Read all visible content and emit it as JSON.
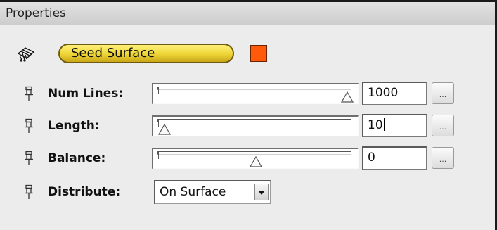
{
  "panel": {
    "title": "Properties"
  },
  "object": {
    "icon": "seed-surface-icon",
    "name": "Seed Surface",
    "color": "#ff5a0a"
  },
  "params": [
    {
      "label": "Num Lines:",
      "value": "1000",
      "slider_level": 1.0,
      "button": "..."
    },
    {
      "label": "Length:",
      "value": "10",
      "slider_level": 0.0,
      "button": "..."
    },
    {
      "label": "Balance:",
      "value": "0",
      "slider_level": 0.5,
      "button": "..."
    }
  ],
  "distribute": {
    "label": "Distribute:",
    "selected": "On Surface"
  }
}
